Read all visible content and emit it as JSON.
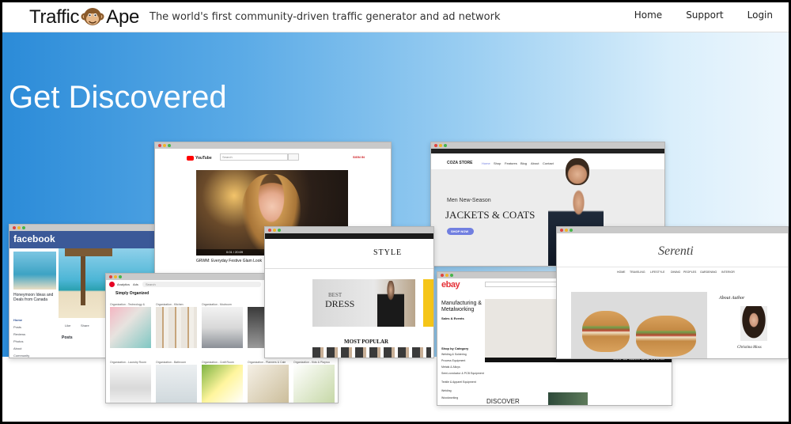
{
  "header": {
    "logo_left": "Traffic",
    "logo_right": "Ape",
    "tagline": "The world's first community-driven traffic generator and ad network",
    "nav": [
      "Home",
      "Support",
      "Login"
    ]
  },
  "hero": {
    "title": "Get Discovered"
  },
  "screens": {
    "youtube": {
      "search_placeholder": "Search",
      "sign_in": "SIGN IN",
      "video_title": "GRWM: Everyday Festive Glam Look",
      "time": "0:01 / 20:09"
    },
    "facebook": {
      "brand": "facebook",
      "page_name": "Honeymoon Ideas and Deals from Canada",
      "menu": [
        "Home",
        "Posts",
        "Reviews",
        "Photos",
        "About",
        "Community"
      ],
      "actions": [
        "Like",
        "Share"
      ],
      "posts_label": "Posts"
    },
    "pinterest": {
      "tabs": [
        "Analytics",
        "Ads"
      ],
      "search": "Search",
      "board": "Simply Organized",
      "pins": [
        "Organization - Technology &",
        "Organization - Kitchen",
        "Organization - Mudroom",
        "Organization - Laundry Room",
        "Organization - Bathroom",
        "Organization - Craft Room",
        "Organization - Planners & Cale",
        "Organization - Kids & Playroo"
      ]
    },
    "coza": {
      "store": "COZA STORE",
      "menu": [
        "Home",
        "Shop",
        "Features",
        "Blog",
        "About",
        "Contact"
      ],
      "season": "Men New-Season",
      "headline": "JACKETS & COATS",
      "cta": "SHOP NOW"
    },
    "style": {
      "brand": "STYLE",
      "banner_small": "BEST",
      "banner_big": "DRESS",
      "popular": "MOST POPULAR",
      "side_text": "THE NEW LOOK IS HERE"
    },
    "ebay": {
      "brand": "ebay",
      "category": "Manufacturing & Metalworking",
      "sections": [
        "Sales & Events",
        "Shop by Category"
      ],
      "items": [
        "Welding & Soldering",
        "Process Equipment",
        "Metals & Alloys",
        "Semi-conductor & PCB Equipment",
        "Textile & Apparel Equipment",
        "Welding",
        "Woodworking"
      ],
      "see_all": "See all sales and events",
      "discover": "DISCOVER"
    },
    "serenti": {
      "brand": "Serenti",
      "menu": [
        "HOME",
        "TRAVELING",
        "LIFESTYLE",
        "DINING",
        "PEOPLES",
        "GARDENING",
        "INTERIOR"
      ],
      "about": "About Author",
      "author": "Christina Moss"
    }
  },
  "colors": {
    "hero_start": "#2b8bd8",
    "hero_end": "#eef7fd",
    "youtube_red": "#ff0000",
    "facebook_blue": "#3b5998",
    "pinterest_red": "#e60023",
    "coza_blue": "#717fe0",
    "ebay_red": "#e53238"
  }
}
